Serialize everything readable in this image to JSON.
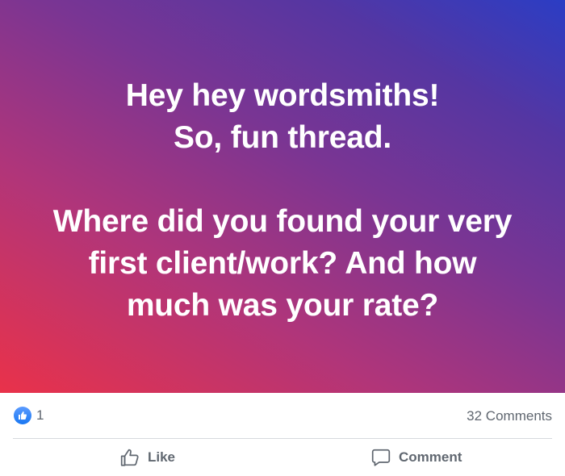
{
  "post": {
    "text_lines": [
      "Hey hey wordsmiths!",
      "So, fun thread.",
      "",
      "Where did you found your very",
      "first client/work? And how",
      "much was your rate?"
    ],
    "gradient_colors": [
      "#e9324a",
      "#b0357a",
      "#7a3593",
      "#5536a2",
      "#2b3dc4"
    ]
  },
  "stats": {
    "reaction_icon": "thumbs-up-icon",
    "reaction_count": "1",
    "comments": "32 Comments"
  },
  "actions": {
    "like": {
      "label": "Like",
      "icon": "thumbs-up-outline-icon"
    },
    "comment": {
      "label": "Comment",
      "icon": "speech-bubble-icon"
    }
  },
  "colors": {
    "accent": "#1877f2",
    "muted_text": "#606770",
    "divider": "#d6d9de"
  }
}
